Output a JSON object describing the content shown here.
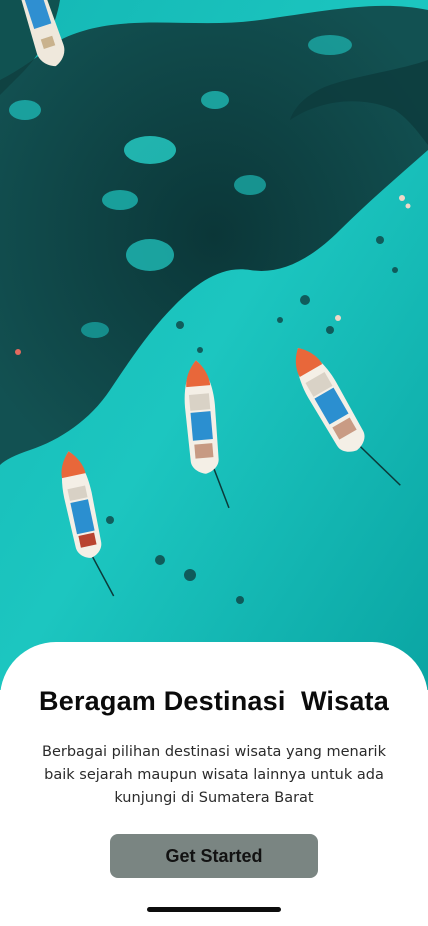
{
  "hero": {
    "image_description": "hero-image",
    "colors": {
      "water_light": "#1fc9c2",
      "water_mid": "#0fa7a6",
      "reef_dark": "#0e3b3c"
    }
  },
  "onboarding": {
    "title": "Beragam Destinasi  Wisata",
    "description": "Berbagai pilihan destinasi wisata yang menarik baik sejarah maupun wisata lainnya untuk ada kunjungi di Sumatera Barat",
    "cta_label": "Get Started"
  },
  "colors": {
    "button": "#7a8582",
    "title": "#0b0b0b",
    "text": "#2b2b2b"
  }
}
